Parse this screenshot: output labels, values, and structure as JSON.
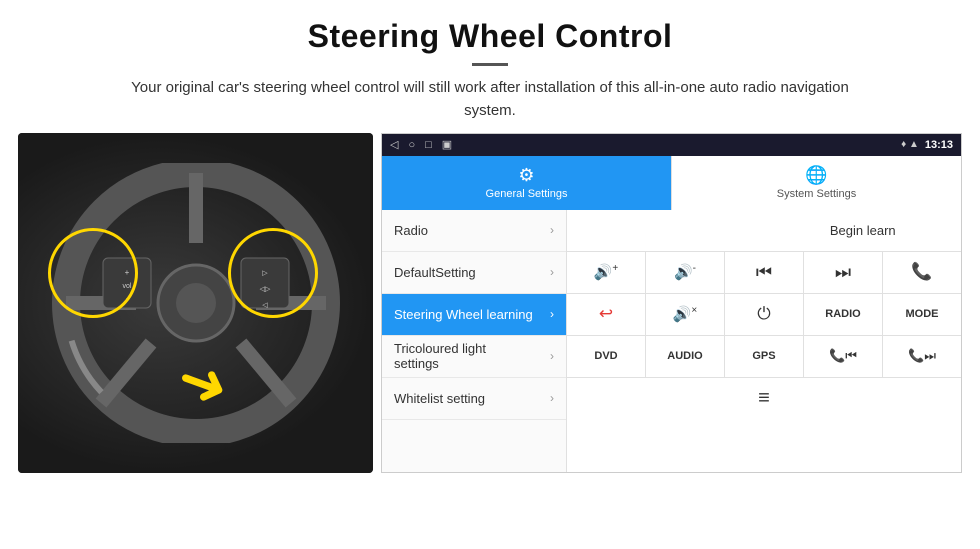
{
  "header": {
    "title": "Steering Wheel Control",
    "subtitle": "Your original car's steering wheel control will still work after installation of this all-in-one auto radio navigation system."
  },
  "statusBar": {
    "time": "13:13",
    "icons": [
      "◁",
      "○",
      "□",
      "▣"
    ]
  },
  "tabs": [
    {
      "id": "general",
      "label": "General Settings",
      "active": true
    },
    {
      "id": "system",
      "label": "System Settings",
      "active": false
    }
  ],
  "menuItems": [
    {
      "label": "Radio",
      "active": false
    },
    {
      "label": "DefaultSetting",
      "active": false
    },
    {
      "label": "Steering Wheel learning",
      "active": true
    },
    {
      "label": "Tricoloured light settings",
      "active": false
    },
    {
      "label": "Whitelist setting",
      "active": false
    }
  ],
  "controls": {
    "beginLearn": "Begin learn",
    "row2": [
      "🔊+",
      "🔊-",
      "⏮",
      "⏭",
      "📞"
    ],
    "row3": [
      "↩",
      "🔊×",
      "⏻",
      "RADIO",
      "MODE"
    ],
    "row4": [
      "DVD",
      "AUDIO",
      "GPS",
      "📞⏮",
      "📞⏭"
    ],
    "row5": [
      "≡"
    ]
  }
}
